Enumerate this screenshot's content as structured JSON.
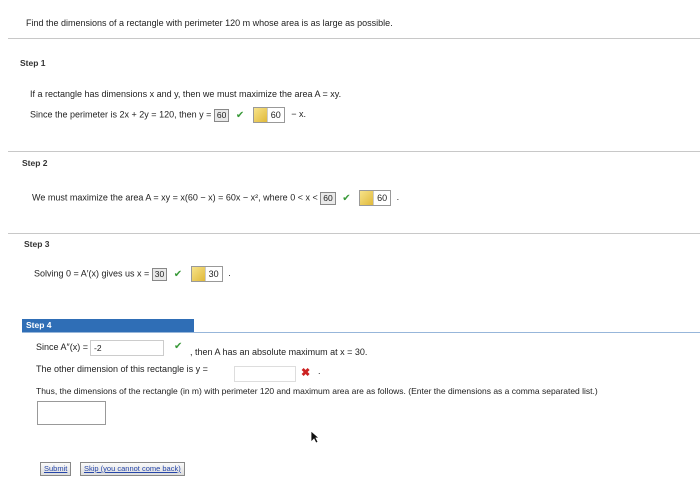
{
  "question": "Find the dimensions of a rectangle with perimeter 120 m whose area is as large as possible.",
  "step1": {
    "title": "Step 1",
    "line1": "If a rectangle has dimensions x and y, then we must maximize the area A = xy.",
    "line2_prefix": "Since the perimeter is 2x + 2y = 120, then y =",
    "answer": "60",
    "feedback": "60",
    "suffix": "− x."
  },
  "step2": {
    "title": "Step 2",
    "line": "We must maximize the area A = xy = x(60 − x) = 60x − x², where 0 < x <",
    "answer": "60",
    "feedback": "60",
    "suffix": "."
  },
  "step3": {
    "title": "Step 3",
    "line": "Solving 0 = A′(x) gives us x =",
    "answer": "30",
    "feedback": "30",
    "suffix": "."
  },
  "step4": {
    "title": "Step 4",
    "line1_prefix": "Since A″(x) =",
    "line1_value": "-2",
    "line1_suffix": ", then A has an absolute maximum at x = 30.",
    "line2": "The other dimension of this rectangle is y =",
    "line2_suffix": ".",
    "line3": "Thus, the dimensions of the rectangle (in m) with perimeter 120 and maximum area are as follows. (Enter the dimensions as a comma separated list.)",
    "submit_label": "Submit",
    "skip_label": "Skip (you cannot come back)"
  },
  "colors": {
    "accent": "#2f6eb6",
    "correct": "#3a9a3a",
    "wrong": "#cc2222"
  }
}
